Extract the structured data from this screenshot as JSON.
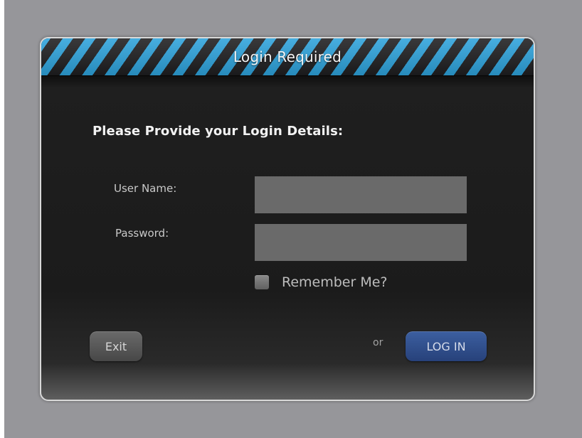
{
  "dialog": {
    "title": "Login Required",
    "heading": "Please Provide your Login Details:",
    "fields": {
      "username": {
        "label": "User Name:",
        "value": "",
        "placeholder": ""
      },
      "password": {
        "label": "Password:",
        "value": "",
        "placeholder": ""
      }
    },
    "remember": {
      "label": "Remember Me?",
      "checked": false
    },
    "buttons": {
      "exit_label": "Exit",
      "or_text": "or",
      "login_label": "LOG IN"
    }
  },
  "colors": {
    "stripe_accent": "#2ea3dc",
    "dialog_background": "#1b1b1b",
    "field_background": "#6a6a6a",
    "login_button": "#2f4e8c",
    "exit_button": "#575757",
    "page_background": "#96969a"
  }
}
